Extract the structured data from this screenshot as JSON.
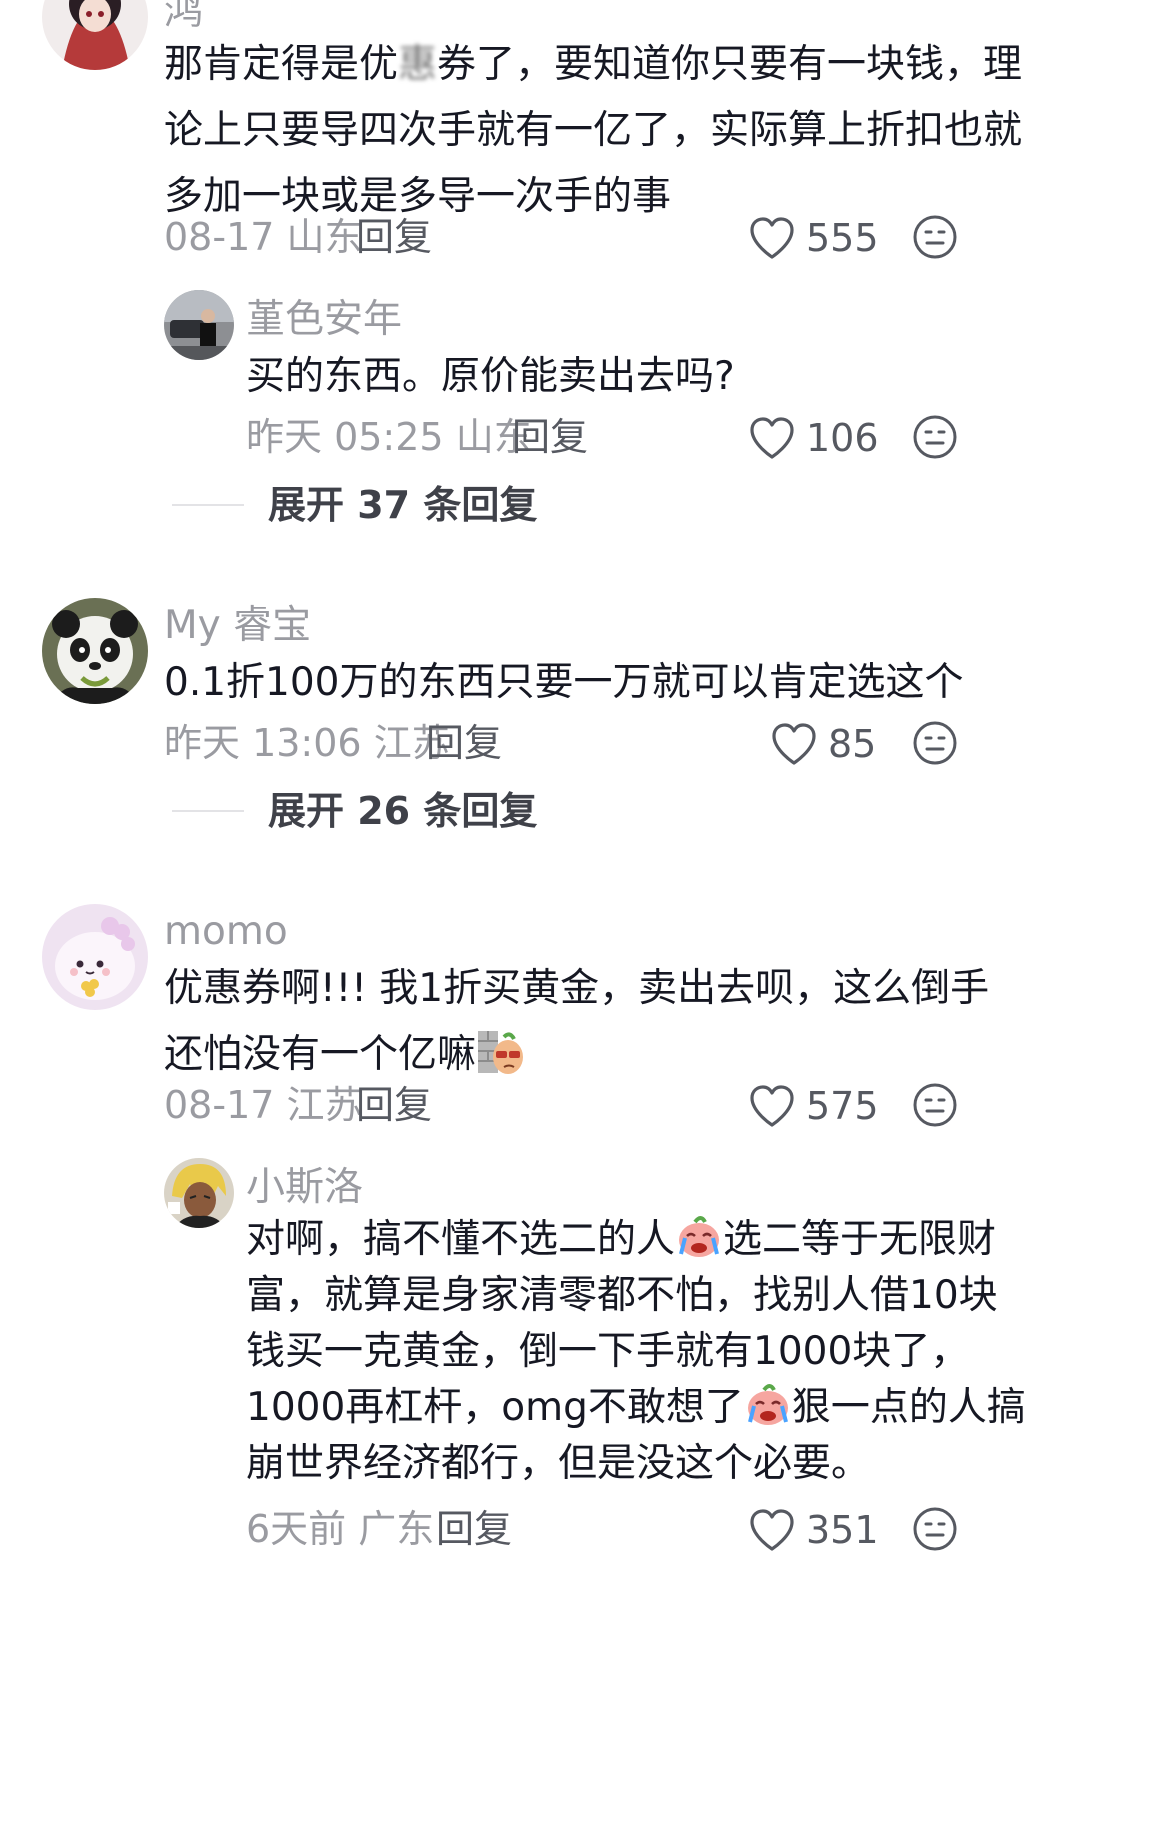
{
  "comments": [
    {
      "username": "鸿",
      "text_lines": [
        "那肯定得是优惠券了，要知道你只要有一块钱，理",
        "论上只要导四次手就有一亿了，实际算上折扣也就",
        "多加一块或是多导一次手的事"
      ],
      "text_prefix": "那肯定得是优",
      "text_blur": "惠",
      "text_suffix": "券了，要知道你只要有一块钱，理",
      "date": "08-17",
      "location": "山东",
      "reply_label": "回复",
      "likes": "555",
      "replies": [
        {
          "username": "堇色安年",
          "text_lines": [
            "买的东西。原价能卖出去吗?"
          ],
          "date": "昨天 05:25",
          "location": "山东",
          "reply_label": "回复",
          "likes": "106"
        }
      ],
      "expand_label": "展开 37 条回复"
    },
    {
      "username": "My 睿宝",
      "text_lines": [
        "0.1折100万的东西只要一万就可以肯定选这个"
      ],
      "date": "昨天 13:06",
      "location": "江苏",
      "reply_label": "回复",
      "likes": "85",
      "expand_label": "展开 26 条回复"
    },
    {
      "username": "momo",
      "text_lines": [
        "优惠券啊!!! 我1折买黄金，卖出去呗，这么倒手",
        "还怕没有一个亿嘛"
      ],
      "date": "08-17",
      "location": "江苏",
      "reply_label": "回复",
      "likes": "575",
      "replies": [
        {
          "username": "小斯洛",
          "line1a": "对啊，搞不懂不选二的人",
          "line1b": "选二等于无限财",
          "line2": "富，就算是身家清零都不怕，找别人借10块",
          "line3": "钱买一克黄金，倒一下手就有1000块了，",
          "line4a": "1000再杠杆，omg不敢想了",
          "line4b": "狠一点的人搞",
          "line5": "崩世界经济都行，但是没这个必要。",
          "date": "6天前",
          "location": "广东",
          "reply_label": "回复",
          "likes": "351"
        }
      ]
    }
  ],
  "icons": {
    "like": "heart-outline-icon",
    "dislike": "meh-face-icon",
    "emoji_cry": "crying-face-emoji",
    "emoji_wall": "peeking-wall-emoji"
  }
}
